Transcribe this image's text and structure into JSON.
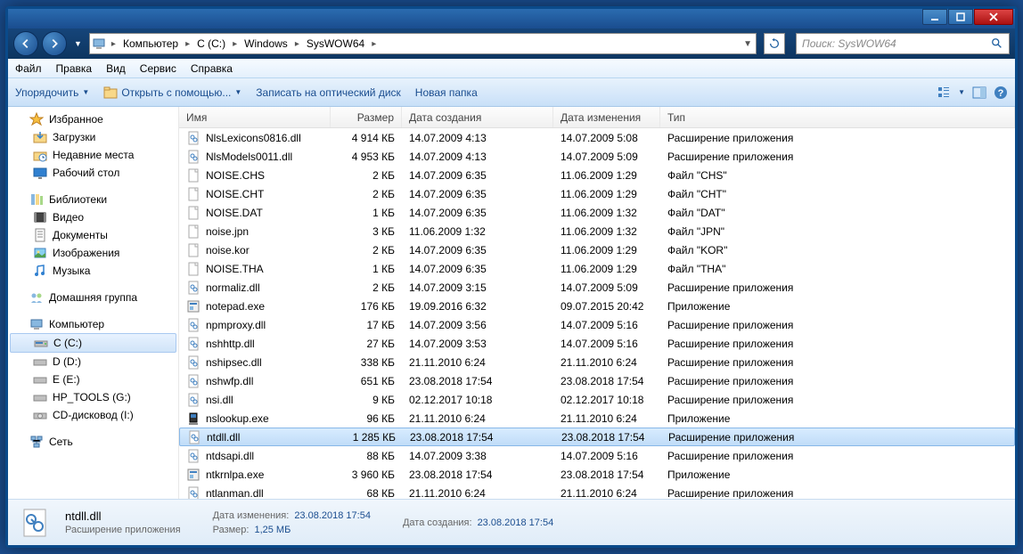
{
  "breadcrumb": [
    "Компьютер",
    "C (C:)",
    "Windows",
    "SysWOW64"
  ],
  "search": {
    "placeholder": "Поиск: SysWOW64"
  },
  "menubar": [
    "Файл",
    "Правка",
    "Вид",
    "Сервис",
    "Справка"
  ],
  "toolbar": {
    "organize": "Упорядочить",
    "openwith": "Открыть с помощью...",
    "burn": "Записать на оптический диск",
    "newfolder": "Новая папка"
  },
  "sidebar": {
    "favorites": {
      "label": "Избранное",
      "items": [
        "Загрузки",
        "Недавние места",
        "Рабочий стол"
      ]
    },
    "libraries": {
      "label": "Библиотеки",
      "items": [
        "Видео",
        "Документы",
        "Изображения",
        "Музыка"
      ]
    },
    "homegroup": {
      "label": "Домашняя группа"
    },
    "computer": {
      "label": "Компьютер",
      "items": [
        "C (C:)",
        "D (D:)",
        "E (E:)",
        "HP_TOOLS (G:)",
        "CD-дисковод (I:)"
      ]
    },
    "network": {
      "label": "Сеть"
    }
  },
  "columns": {
    "name": "Имя",
    "size": "Размер",
    "created": "Дата создания",
    "modified": "Дата изменения",
    "type": "Тип"
  },
  "files": [
    {
      "name": "NlsLexicons0816.dll",
      "size": "4 914 КБ",
      "created": "14.07.2009 4:13",
      "modified": "14.07.2009 5:08",
      "type": "Расширение приложения",
      "icon": "dll"
    },
    {
      "name": "NlsModels0011.dll",
      "size": "4 953 КБ",
      "created": "14.07.2009 4:13",
      "modified": "14.07.2009 5:09",
      "type": "Расширение приложения",
      "icon": "dll"
    },
    {
      "name": "NOISE.CHS",
      "size": "2 КБ",
      "created": "14.07.2009 6:35",
      "modified": "11.06.2009 1:29",
      "type": "Файл \"CHS\"",
      "icon": "file"
    },
    {
      "name": "NOISE.CHT",
      "size": "2 КБ",
      "created": "14.07.2009 6:35",
      "modified": "11.06.2009 1:29",
      "type": "Файл \"CHT\"",
      "icon": "file"
    },
    {
      "name": "NOISE.DAT",
      "size": "1 КБ",
      "created": "14.07.2009 6:35",
      "modified": "11.06.2009 1:32",
      "type": "Файл \"DAT\"",
      "icon": "file"
    },
    {
      "name": "noise.jpn",
      "size": "3 КБ",
      "created": "11.06.2009 1:32",
      "modified": "11.06.2009 1:32",
      "type": "Файл \"JPN\"",
      "icon": "file"
    },
    {
      "name": "noise.kor",
      "size": "2 КБ",
      "created": "14.07.2009 6:35",
      "modified": "11.06.2009 1:29",
      "type": "Файл \"KOR\"",
      "icon": "file"
    },
    {
      "name": "NOISE.THA",
      "size": "1 КБ",
      "created": "14.07.2009 6:35",
      "modified": "11.06.2009 1:29",
      "type": "Файл \"THA\"",
      "icon": "file"
    },
    {
      "name": "normaliz.dll",
      "size": "2 КБ",
      "created": "14.07.2009 3:15",
      "modified": "14.07.2009 5:09",
      "type": "Расширение приложения",
      "icon": "dll"
    },
    {
      "name": "notepad.exe",
      "size": "176 КБ",
      "created": "19.09.2016 6:32",
      "modified": "09.07.2015 20:42",
      "type": "Приложение",
      "icon": "exe"
    },
    {
      "name": "npmproxy.dll",
      "size": "17 КБ",
      "created": "14.07.2009 3:56",
      "modified": "14.07.2009 5:16",
      "type": "Расширение приложения",
      "icon": "dll"
    },
    {
      "name": "nshhttp.dll",
      "size": "27 КБ",
      "created": "14.07.2009 3:53",
      "modified": "14.07.2009 5:16",
      "type": "Расширение приложения",
      "icon": "dll"
    },
    {
      "name": "nshipsec.dll",
      "size": "338 КБ",
      "created": "21.11.2010 6:24",
      "modified": "21.11.2010 6:24",
      "type": "Расширение приложения",
      "icon": "dll"
    },
    {
      "name": "nshwfp.dll",
      "size": "651 КБ",
      "created": "23.08.2018 17:54",
      "modified": "23.08.2018 17:54",
      "type": "Расширение приложения",
      "icon": "dll"
    },
    {
      "name": "nsi.dll",
      "size": "9 КБ",
      "created": "02.12.2017 10:18",
      "modified": "02.12.2017 10:18",
      "type": "Расширение приложения",
      "icon": "dll"
    },
    {
      "name": "nslookup.exe",
      "size": "96 КБ",
      "created": "21.11.2010 6:24",
      "modified": "21.11.2010 6:24",
      "type": "Приложение",
      "icon": "exe2"
    },
    {
      "name": "ntdll.dll",
      "size": "1 285 КБ",
      "created": "23.08.2018 17:54",
      "modified": "23.08.2018 17:54",
      "type": "Расширение приложения",
      "icon": "dll",
      "selected": true
    },
    {
      "name": "ntdsapi.dll",
      "size": "88 КБ",
      "created": "14.07.2009 3:38",
      "modified": "14.07.2009 5:16",
      "type": "Расширение приложения",
      "icon": "dll"
    },
    {
      "name": "ntkrnlpa.exe",
      "size": "3 960 КБ",
      "created": "23.08.2018 17:54",
      "modified": "23.08.2018 17:54",
      "type": "Приложение",
      "icon": "exe"
    },
    {
      "name": "ntlanman.dll",
      "size": "68 КБ",
      "created": "21.11.2010 6:24",
      "modified": "21.11.2010 6:24",
      "type": "Расширение приложения",
      "icon": "dll"
    }
  ],
  "status": {
    "filename": "ntdll.dll",
    "typetext": "Расширение приложения",
    "props": {
      "modified_label": "Дата изменения:",
      "modified_val": "23.08.2018 17:54",
      "size_label": "Размер:",
      "size_val": "1,25 МБ",
      "created_label": "Дата создания:",
      "created_val": "23.08.2018 17:54"
    }
  }
}
